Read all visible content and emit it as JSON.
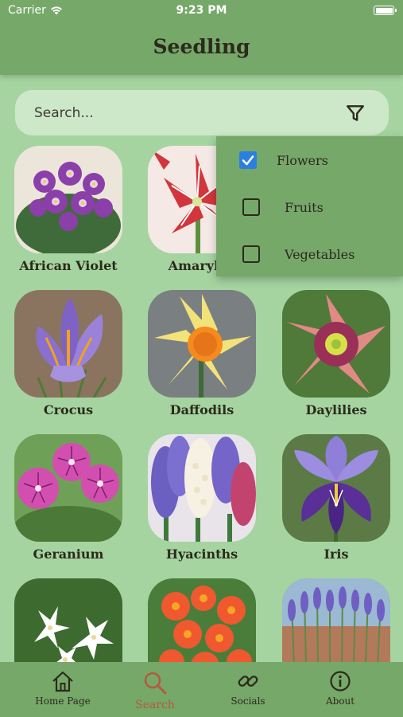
{
  "status_bar": {
    "carrier": "Carrier",
    "time": "9:23 PM"
  },
  "header": {
    "title": "Seedling"
  },
  "search": {
    "placeholder": "Search..."
  },
  "filter_menu": {
    "options": [
      {
        "label": "Flowers",
        "checked": true
      },
      {
        "label": "Fruits",
        "checked": false
      },
      {
        "label": "Vegetables",
        "checked": false
      }
    ]
  },
  "plants": [
    {
      "name": "African Violet"
    },
    {
      "name": "Amaryllis"
    },
    {
      "name": ""
    },
    {
      "name": "Crocus"
    },
    {
      "name": "Daffodils"
    },
    {
      "name": "Daylilies"
    },
    {
      "name": "Geranium"
    },
    {
      "name": "Hyacinths"
    },
    {
      "name": "Iris"
    },
    {
      "name": ""
    },
    {
      "name": ""
    },
    {
      "name": ""
    }
  ],
  "tabbar": {
    "tabs": [
      {
        "label": "Home Page",
        "icon": "home-icon"
      },
      {
        "label": "Search",
        "icon": "search-icon",
        "active": true
      },
      {
        "label": "Socials",
        "icon": "link-icon"
      },
      {
        "label": "About",
        "icon": "info-icon"
      }
    ]
  },
  "colors": {
    "background": "#a5d4a0",
    "bar": "#76a869",
    "search_field": "#cde8c9",
    "active_tab": "#b35a3e",
    "checkbox": "#2a7fe0"
  }
}
